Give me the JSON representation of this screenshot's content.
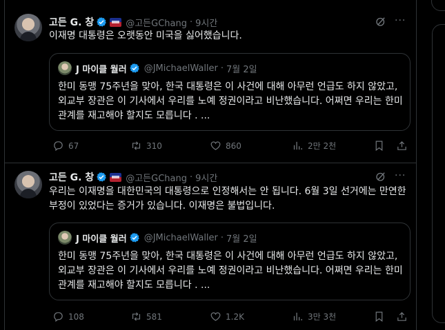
{
  "posts": [
    {
      "author_name": "고든 G. 창",
      "author_handle": "@고든GChang",
      "time": "9시간",
      "more_icon": "ellipsis-icon",
      "text": "이재명 대통령은 오랫동안 미국을 싫어했습니다.",
      "quote": {
        "author_name": "J 마이클 월러",
        "author_handle": "@JMichaelWaller",
        "time": "7월 2일",
        "text": "한미 동맹 75주년을 맞아, 한국 대통령은 이 사건에 대해 아무런 언급도 하지 않았고, 외교부 장관은 이 기사에서 우리를 노예 정권이라고 비난했습니다. 어쩌면 우리는 한미 관계를 재고해야 할지도 모릅니다 . ..."
      },
      "stats": {
        "replies": "67",
        "reposts": "310",
        "likes": "860",
        "views": "2만 2천"
      }
    },
    {
      "author_name": "고든 G. 창",
      "author_handle": "@고든GChang",
      "time": "9시간",
      "text": "우리는 이재명을 대한민국의 대통령으로 인정해서는 안 됩니다. 6월 3일 선거에는 만연한 부정이 있었다는 증거가 있습니다. 이재명은 불법입니다.",
      "quote": {
        "author_name": "J 마이클 월러",
        "author_handle": "@JMichaelWaller",
        "time": "7월 2일",
        "text": "한미 동맹 75주년을 맞아, 한국 대통령은 이 사건에 대해 아무런 언급도 하지 않았고, 외교부 장관은 이 기사에서 우리를 노예 정권이라고 비난했습니다. 어쩌면 우리는 한미 관계를 재고해야 할지도 모릅니다 . ..."
      },
      "stats": {
        "replies": "108",
        "reposts": "581",
        "likes": "1.2K",
        "views": "3만 3천"
      }
    }
  ],
  "colors": {
    "background": "#000000",
    "text": "#e7e9ea",
    "muted": "#71767b",
    "verified": "#1d9bf0",
    "border": "#2f3336"
  },
  "icons": [
    "verified-badge-icon",
    "affiliate-flag-icon",
    "grok-icon",
    "reply-icon",
    "repost-icon",
    "like-icon",
    "views-icon",
    "bookmark-icon",
    "share-icon"
  ]
}
